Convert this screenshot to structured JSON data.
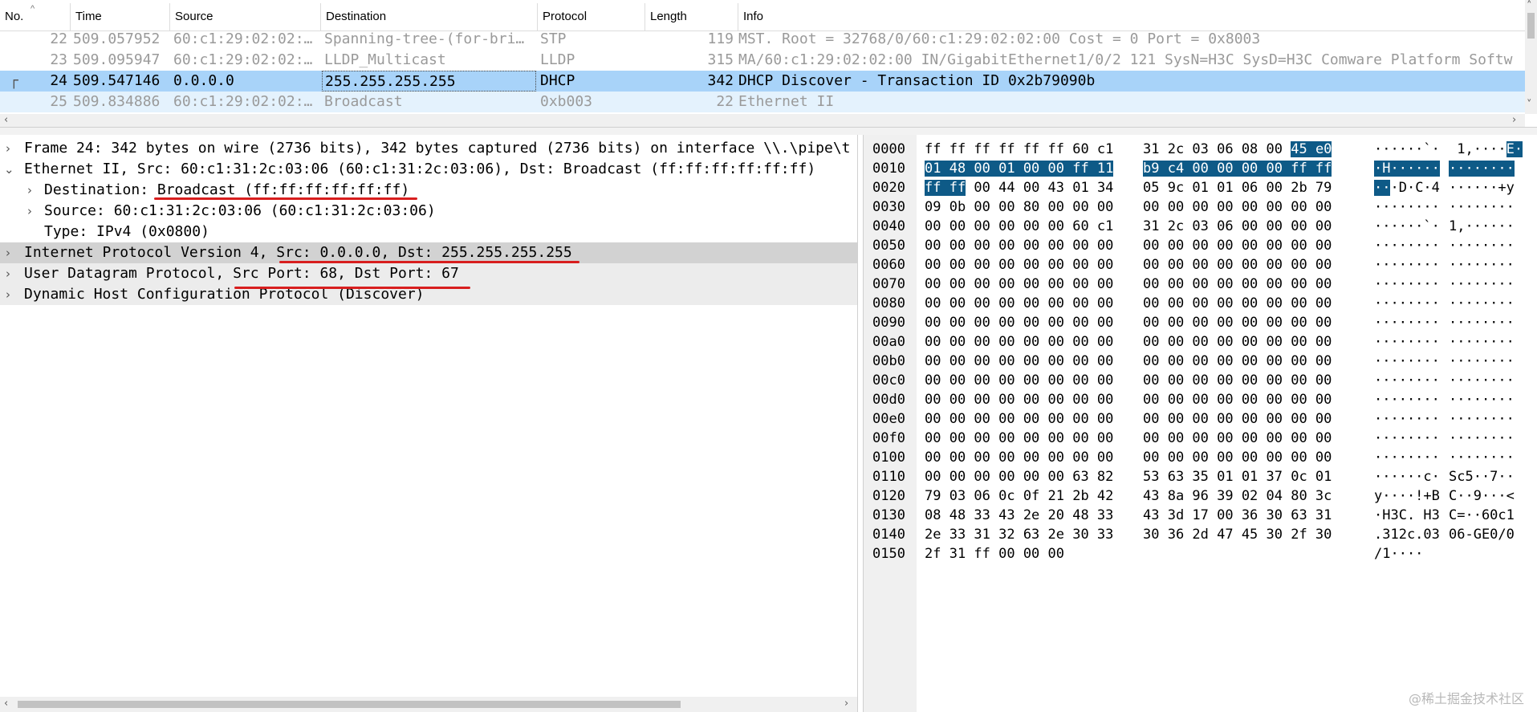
{
  "packet_list": {
    "columns": [
      "No.",
      "Time",
      "Source",
      "Destination",
      "Protocol",
      "Length",
      "Info"
    ],
    "rows": [
      {
        "no": "22",
        "time": "509.057952",
        "source": "60:c1:29:02:02:…",
        "destination": "Spanning-tree-(for-bri…",
        "protocol": "STP",
        "length": "119",
        "info": "MST. Root = 32768/0/60:c1:29:02:02:00  Cost = 0  Port = 0x8003"
      },
      {
        "no": "23",
        "time": "509.095947",
        "source": "60:c1:29:02:02:…",
        "destination": "LLDP_Multicast",
        "protocol": "LLDP",
        "length": "315",
        "info": "MA/60:c1:29:02:02:00 IN/GigabitEthernet1/0/2 121 SysN=H3C SysD=H3C Comware Platform Softw"
      },
      {
        "no": "24",
        "time": "509.547146",
        "source": "0.0.0.0",
        "destination": "255.255.255.255",
        "protocol": "DHCP",
        "length": "342",
        "info": "DHCP Discover - Transaction ID 0x2b79090b"
      },
      {
        "no": "25",
        "time": "509.834886",
        "source": "60:c1:29:02:02:…",
        "destination": "Broadcast",
        "protocol": "0xb003",
        "length": "22",
        "info": "Ethernet II"
      }
    ]
  },
  "details": {
    "frame": "Frame 24: 342 bytes on wire (2736 bits), 342 bytes captured (2736 bits) on interface \\\\.\\pipe\\t",
    "ethernet": "Ethernet II, Src: 60:c1:31:2c:03:06 (60:c1:31:2c:03:06), Dst: Broadcast (ff:ff:ff:ff:ff:ff)",
    "eth_destination": "Destination: Broadcast (ff:ff:ff:ff:ff:ff)",
    "eth_source": "Source: 60:c1:31:2c:03:06 (60:c1:31:2c:03:06)",
    "eth_type": "Type: IPv4 (0x0800)",
    "ip": "Internet Protocol Version 4, Src: 0.0.0.0, Dst: 255.255.255.255",
    "udp": "User Datagram Protocol, Src Port: 68, Dst Port: 67",
    "dhcp": "Dynamic Host Configuration Protocol (Discover)"
  },
  "bytes": {
    "rows": [
      {
        "offset": "0000",
        "hex1": "ff ff ff ff ff ff 60 c1",
        "hex2": "31 2c 03 06 08 00 45 e0",
        "ascii1": "······`·",
        "ascii2": " 1,····E·"
      },
      {
        "offset": "0010",
        "hex1": "01 48 00 01 00 00 ff 11",
        "hex2": "b9 c4 00 00 00 00 ff ff",
        "ascii1": "·H······",
        "ascii2": "········"
      },
      {
        "offset": "0020",
        "hex1": "ff ff 00 44 00 43 01 34",
        "hex2": "05 9c 01 01 06 00 2b 79",
        "ascii1": "···D·C·4",
        "ascii2": "······+y"
      },
      {
        "offset": "0030",
        "hex1": "09 0b 00 00 80 00 00 00",
        "hex2": "00 00 00 00 00 00 00 00",
        "ascii1": "········",
        "ascii2": "········"
      },
      {
        "offset": "0040",
        "hex1": "00 00 00 00 00 00 60 c1",
        "hex2": "31 2c 03 06 00 00 00 00",
        "ascii1": "······`·",
        "ascii2": "1,······"
      },
      {
        "offset": "0050",
        "hex1": "00 00 00 00 00 00 00 00",
        "hex2": "00 00 00 00 00 00 00 00",
        "ascii1": "········",
        "ascii2": "········"
      },
      {
        "offset": "0060",
        "hex1": "00 00 00 00 00 00 00 00",
        "hex2": "00 00 00 00 00 00 00 00",
        "ascii1": "········",
        "ascii2": "········"
      },
      {
        "offset": "0070",
        "hex1": "00 00 00 00 00 00 00 00",
        "hex2": "00 00 00 00 00 00 00 00",
        "ascii1": "········",
        "ascii2": "········"
      },
      {
        "offset": "0080",
        "hex1": "00 00 00 00 00 00 00 00",
        "hex2": "00 00 00 00 00 00 00 00",
        "ascii1": "········",
        "ascii2": "········"
      },
      {
        "offset": "0090",
        "hex1": "00 00 00 00 00 00 00 00",
        "hex2": "00 00 00 00 00 00 00 00",
        "ascii1": "········",
        "ascii2": "········"
      },
      {
        "offset": "00a0",
        "hex1": "00 00 00 00 00 00 00 00",
        "hex2": "00 00 00 00 00 00 00 00",
        "ascii1": "········",
        "ascii2": "········"
      },
      {
        "offset": "00b0",
        "hex1": "00 00 00 00 00 00 00 00",
        "hex2": "00 00 00 00 00 00 00 00",
        "ascii1": "········",
        "ascii2": "········"
      },
      {
        "offset": "00c0",
        "hex1": "00 00 00 00 00 00 00 00",
        "hex2": "00 00 00 00 00 00 00 00",
        "ascii1": "········",
        "ascii2": "········"
      },
      {
        "offset": "00d0",
        "hex1": "00 00 00 00 00 00 00 00",
        "hex2": "00 00 00 00 00 00 00 00",
        "ascii1": "········",
        "ascii2": "········"
      },
      {
        "offset": "00e0",
        "hex1": "00 00 00 00 00 00 00 00",
        "hex2": "00 00 00 00 00 00 00 00",
        "ascii1": "········",
        "ascii2": "········"
      },
      {
        "offset": "00f0",
        "hex1": "00 00 00 00 00 00 00 00",
        "hex2": "00 00 00 00 00 00 00 00",
        "ascii1": "········",
        "ascii2": "········"
      },
      {
        "offset": "0100",
        "hex1": "00 00 00 00 00 00 00 00",
        "hex2": "00 00 00 00 00 00 00 00",
        "ascii1": "········",
        "ascii2": "········"
      },
      {
        "offset": "0110",
        "hex1": "00 00 00 00 00 00 63 82",
        "hex2": "53 63 35 01 01 37 0c 01",
        "ascii1": "······c·",
        "ascii2": "Sc5··7··"
      },
      {
        "offset": "0120",
        "hex1": "79 03 06 0c 0f 21 2b 42",
        "hex2": "43 8a 96 39 02 04 80 3c",
        "ascii1": "y····!+B",
        "ascii2": "C··9···<"
      },
      {
        "offset": "0130",
        "hex1": "08 48 33 43 2e 20 48 33",
        "hex2": "43 3d 17 00 36 30 63 31",
        "ascii1": "·H3C. H3",
        "ascii2": "C=··60c1"
      },
      {
        "offset": "0140",
        "hex1": "2e 33 31 32 63 2e 30 33",
        "hex2": "30 36 2d 47 45 30 2f 30",
        "ascii1": ".312c.03",
        "ascii2": "06-GE0/0"
      },
      {
        "offset": "0150",
        "hex1": "2f 31 ff 00 00 00",
        "hex2": "",
        "ascii1": "/1····",
        "ascii2": ""
      }
    ]
  },
  "watermark": "@稀土掘金技术社区",
  "colors": {
    "selected_row": "#a8d3f9",
    "byte_highlight": "#0e5a87",
    "annotation_underline": "#d81e1e"
  }
}
